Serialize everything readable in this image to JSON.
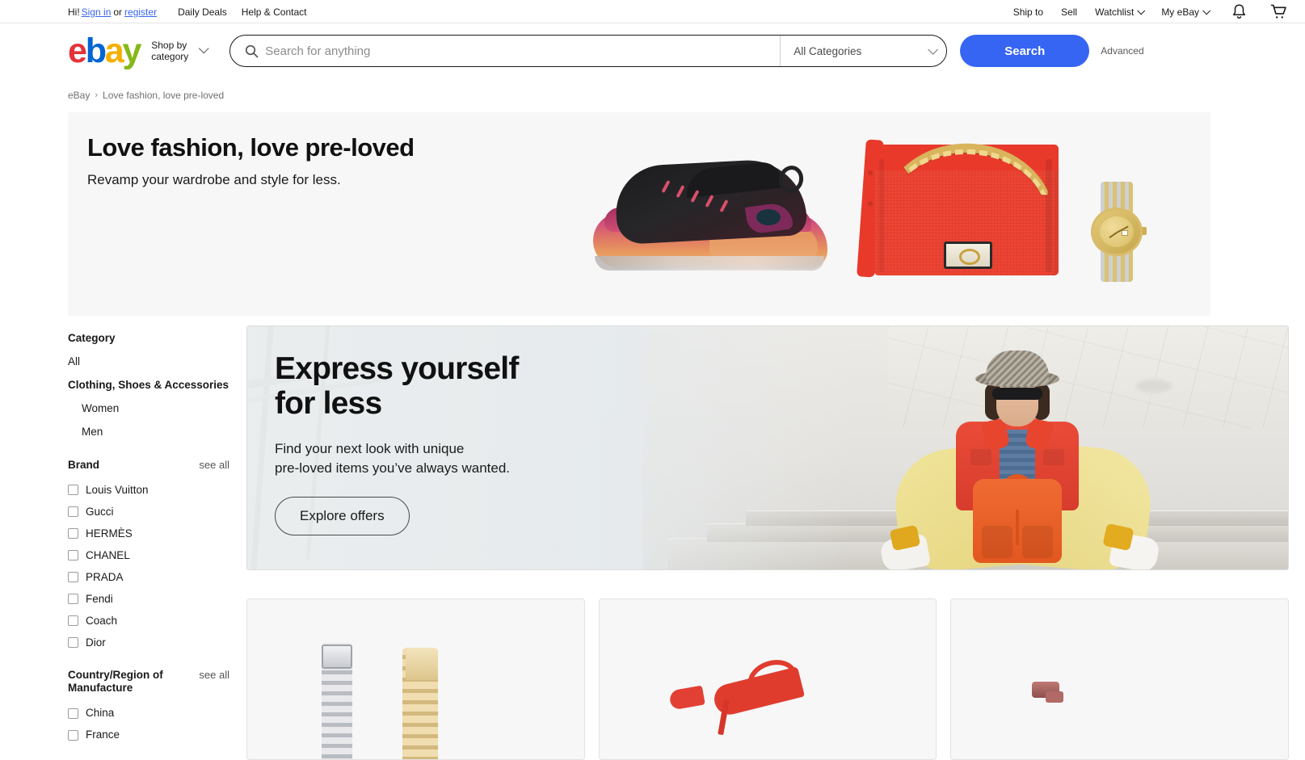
{
  "utility_bar": {
    "greeting": "Hi!",
    "sign_in": "Sign in",
    "or": "or",
    "register": "register",
    "daily_deals": "Daily Deals",
    "help_contact": "Help & Contact",
    "ship_to": "Ship to",
    "sell": "Sell",
    "watchlist": "Watchlist",
    "my_ebay": "My eBay",
    "notifications_icon": "bell-icon",
    "cart_icon": "shopping-cart-icon"
  },
  "header": {
    "logo": {
      "e": "e",
      "b": "b",
      "a": "a",
      "y": "y",
      "color_e": "#e53238",
      "color_b": "#0064d2",
      "color_a": "#f5af02",
      "color_y": "#86b817"
    },
    "shop_by_category": "Shop by\ncategory",
    "search": {
      "placeholder": "Search for anything",
      "value": "",
      "icon": "search-icon"
    },
    "category_select": {
      "selected": "All Categories"
    },
    "search_button": "Search",
    "advanced_link": "Advanced"
  },
  "breadcrumb": {
    "items": [
      "eBay",
      "Love fashion, love pre-loved"
    ],
    "separator": "›"
  },
  "hero": {
    "title": "Love fashion, love pre-loved",
    "subtitle": "Revamp your wardrobe and style for less.",
    "background_color": "#f7f7f7",
    "products": [
      "black-pink-sneaker",
      "red-chanel-boy-bag",
      "gold-steel-wristwatch"
    ]
  },
  "sidebar": {
    "category": {
      "title": "Category",
      "items": [
        {
          "label": "All",
          "level": 0,
          "bold": false
        },
        {
          "label": "Clothing, Shoes & Accessories",
          "level": 0,
          "bold": true
        },
        {
          "label": "Women",
          "level": 1,
          "bold": false
        },
        {
          "label": "Men",
          "level": 1,
          "bold": false
        }
      ]
    },
    "brand": {
      "title": "Brand",
      "see_all": "see all",
      "options": [
        {
          "label": "Louis Vuitton",
          "checked": false
        },
        {
          "label": "Gucci",
          "checked": false
        },
        {
          "label": "HERMÈS",
          "checked": false
        },
        {
          "label": "CHANEL",
          "checked": false
        },
        {
          "label": "PRADA",
          "checked": false
        },
        {
          "label": "Fendi",
          "checked": false
        },
        {
          "label": "Coach",
          "checked": false
        },
        {
          "label": "Dior",
          "checked": false
        }
      ]
    },
    "country": {
      "title": "Country/Region of Manufacture",
      "see_all": "see all",
      "options": [
        {
          "label": "China",
          "checked": false
        },
        {
          "label": "France",
          "checked": false
        }
      ]
    }
  },
  "promo": {
    "title": "Express yourself\nfor less",
    "subtitle": "Find your next look with unique\npre-loved items you’ve always wanted.",
    "button": "Explore offers",
    "image_alt": "woman-sitting-on-stairs-red-jacket-yellow-pants-orange-backpack"
  },
  "cards": [
    {
      "name": "watch-bracelets-card",
      "image_alt": "silver-and-gold-watch-bracelets"
    },
    {
      "name": "red-heels-card",
      "image_alt": "red-high-heel-shoes"
    },
    {
      "name": "accessory-card",
      "image_alt": "small-pink-accessory"
    }
  ]
}
